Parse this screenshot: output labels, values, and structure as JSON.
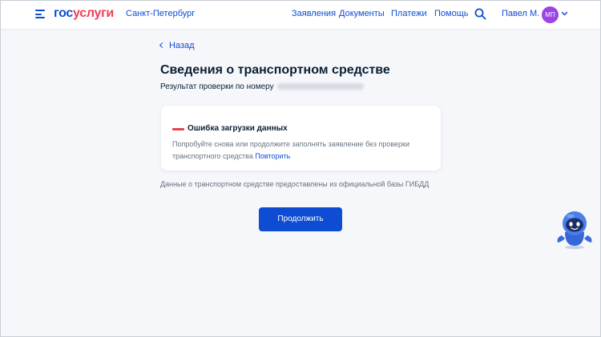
{
  "header": {
    "logo_part1": "гос",
    "logo_part2": "услуги",
    "region": "Санкт-Петербург",
    "nav": [
      "Заявления",
      "Документы",
      "Платежи",
      "Помощь"
    ],
    "user_name": "Павел М.",
    "avatar_initials": "МП"
  },
  "main": {
    "back_label": "Назад",
    "title": "Сведения о транспортном средстве",
    "subtitle": "Результат проверки по номеру",
    "error": {
      "title": "Ошибка загрузки данных",
      "text": "Попробуйте снова или продолжите заполнять заявление без проверки транспортного средства",
      "retry_label": "Повторить"
    },
    "source_note": "Данные о транспортном средстве предоставлены из официальной базы ГИБДД",
    "continue_label": "Продолжить"
  },
  "icons": {
    "menu": "hamburger-menu-icon",
    "search": "search-icon",
    "dropdown": "chevron-down-icon",
    "back": "chevron-left-icon",
    "assistant": "robot-assistant-icon"
  },
  "colors": {
    "accent": "#0d4cd3",
    "logo_red": "#ee3f58",
    "error": "#e3434f",
    "avatar": "#9b45e4",
    "background": "#f5f7fb"
  }
}
